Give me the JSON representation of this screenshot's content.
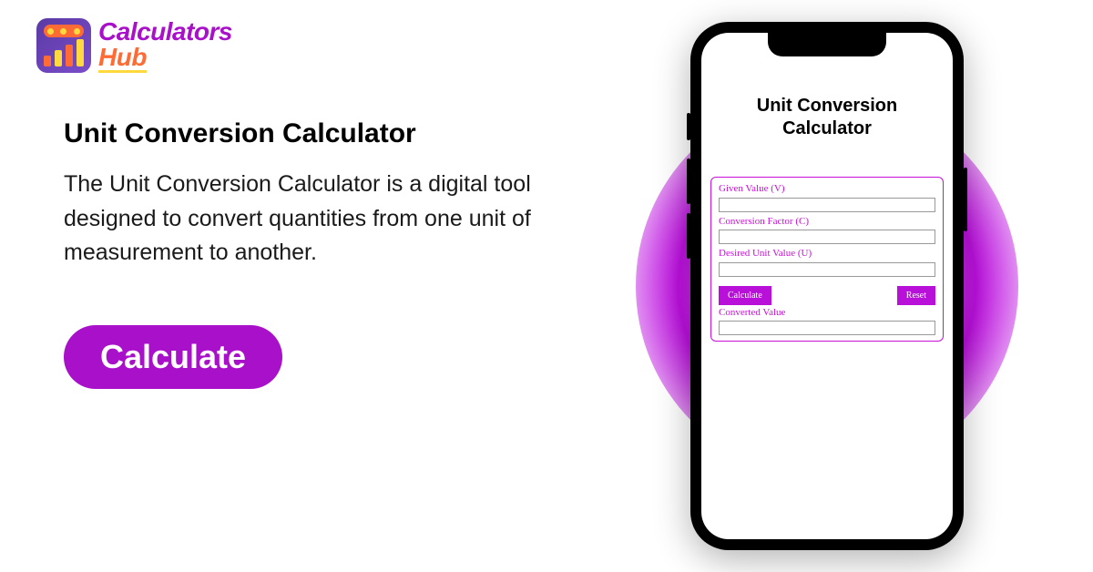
{
  "logo": {
    "text_top": "Calculators",
    "text_bottom": "Hub"
  },
  "left": {
    "heading": "Unit Conversion Calculator",
    "description": "The Unit Conversion Calculator is a digital tool designed to convert quantities from one unit of measurement to another.",
    "cta_label": "Calculate"
  },
  "phone": {
    "app_title_line1": "Unit Conversion",
    "app_title_line2": "Calculator",
    "form": {
      "given_value_label": "Given Value (V)",
      "given_value_input": "",
      "conversion_factor_label": "Conversion Factor (C)",
      "conversion_factor_input": "",
      "desired_unit_label": "Desired Unit Value (U)",
      "desired_unit_input": "",
      "calculate_label": "Calculate",
      "reset_label": "Reset",
      "converted_value_label": "Converted Value",
      "converted_value_input": ""
    }
  },
  "colors": {
    "accent": "#a810c9",
    "form_border": "#c810d9"
  }
}
